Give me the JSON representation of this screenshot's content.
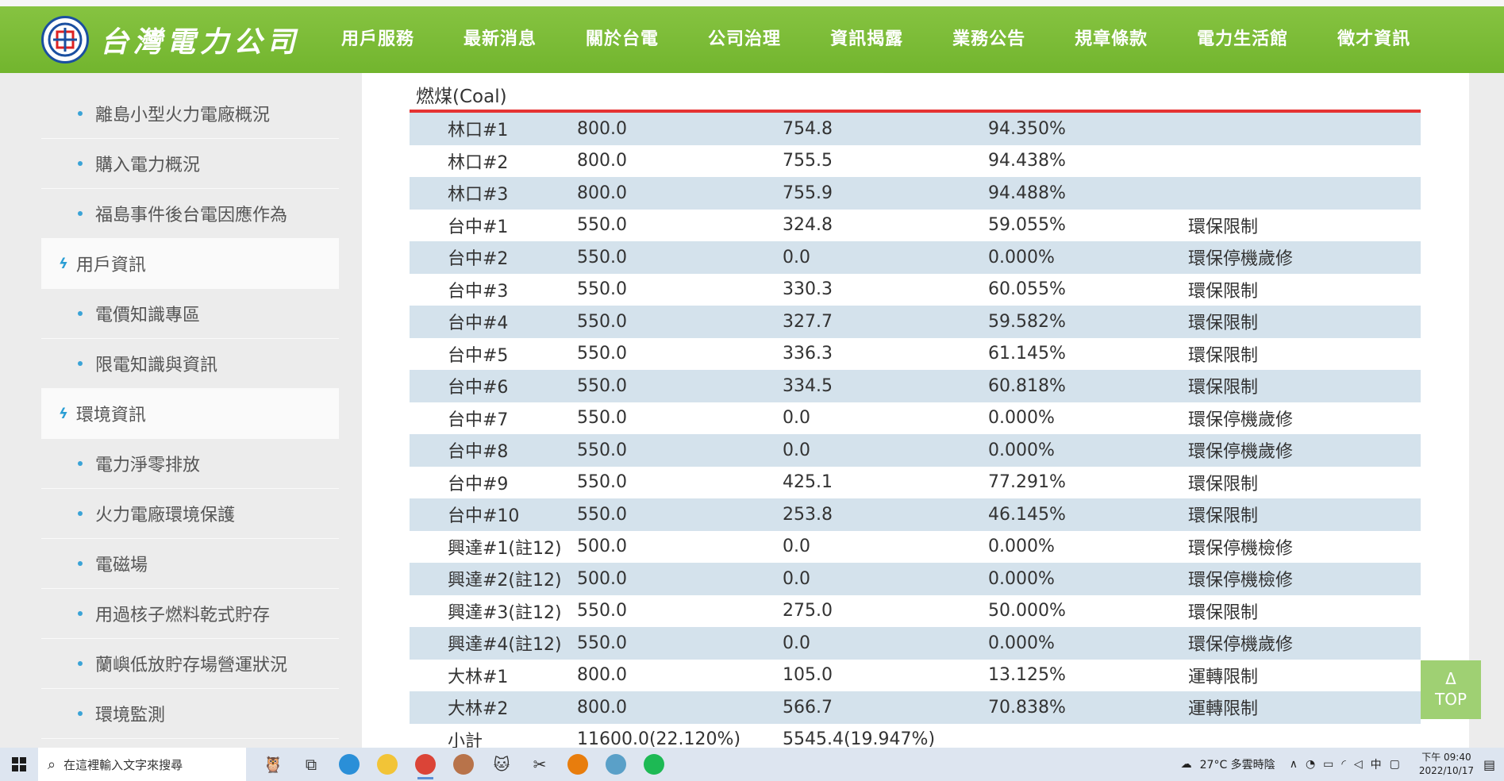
{
  "header": {
    "logo_text": "台灣電力公司",
    "nav": [
      "用戶服務",
      "最新消息",
      "關於台電",
      "公司治理",
      "資訊揭露",
      "業務公告",
      "規章條款",
      "電力生活館",
      "徵才資訊"
    ],
    "active_index": 4,
    "color": "#76b830"
  },
  "sidebar": {
    "items": [
      {
        "type": "sub",
        "label": "離島小型火力電廠概況"
      },
      {
        "type": "sub",
        "label": "購入電力概況"
      },
      {
        "type": "sub",
        "label": "福島事件後台電因應作為"
      },
      {
        "type": "cat",
        "label": "用戶資訊"
      },
      {
        "type": "sub",
        "label": "電價知識專區"
      },
      {
        "type": "sub",
        "label": "限電知識與資訊"
      },
      {
        "type": "cat",
        "label": "環境資訊"
      },
      {
        "type": "sub",
        "label": "電力淨零排放"
      },
      {
        "type": "sub",
        "label": "火力電廠環境保護"
      },
      {
        "type": "sub",
        "label": "電磁場"
      },
      {
        "type": "sub",
        "label": "用過核子燃料乾式貯存"
      },
      {
        "type": "sub",
        "label": "蘭嶼低放貯存場營運狀況"
      },
      {
        "type": "sub",
        "label": "環境監測"
      }
    ]
  },
  "content": {
    "section_title": "燃煤(Coal)",
    "accent_line_color": "#e53333",
    "row_color": "#d4e2ec",
    "rows": [
      [
        "林口#1",
        "800.0",
        "754.8",
        "94.350%",
        ""
      ],
      [
        "林口#2",
        "800.0",
        "755.5",
        "94.438%",
        ""
      ],
      [
        "林口#3",
        "800.0",
        "755.9",
        "94.488%",
        ""
      ],
      [
        "台中#1",
        "550.0",
        "324.8",
        "59.055%",
        "環保限制"
      ],
      [
        "台中#2",
        "550.0",
        "0.0",
        "0.000%",
        "環保停機歲修"
      ],
      [
        "台中#3",
        "550.0",
        "330.3",
        "60.055%",
        "環保限制"
      ],
      [
        "台中#4",
        "550.0",
        "327.7",
        "59.582%",
        "環保限制"
      ],
      [
        "台中#5",
        "550.0",
        "336.3",
        "61.145%",
        "環保限制"
      ],
      [
        "台中#6",
        "550.0",
        "334.5",
        "60.818%",
        "環保限制"
      ],
      [
        "台中#7",
        "550.0",
        "0.0",
        "0.000%",
        "環保停機歲修"
      ],
      [
        "台中#8",
        "550.0",
        "0.0",
        "0.000%",
        "環保停機歲修"
      ],
      [
        "台中#9",
        "550.0",
        "425.1",
        "77.291%",
        "環保限制"
      ],
      [
        "台中#10",
        "550.0",
        "253.8",
        "46.145%",
        "環保限制"
      ],
      [
        "興達#1(註12)",
        "500.0",
        "0.0",
        "0.000%",
        "環保停機檢修"
      ],
      [
        "興達#2(註12)",
        "500.0",
        "0.0",
        "0.000%",
        "環保停機檢修"
      ],
      [
        "興達#3(註12)",
        "550.0",
        "275.0",
        "50.000%",
        "環保限制"
      ],
      [
        "興達#4(註12)",
        "550.0",
        "0.0",
        "0.000%",
        "環保停機歲修"
      ],
      [
        "大林#1",
        "800.0",
        "105.0",
        "13.125%",
        "運轉限制"
      ],
      [
        "大林#2",
        "800.0",
        "566.7",
        "70.838%",
        "運轉限制"
      ],
      [
        "小計",
        "11600.0(22.120%)",
        "5545.4(19.947%)",
        "",
        ""
      ]
    ]
  },
  "top_button": {
    "arrow": "Δ",
    "label": "TOP"
  },
  "taskbar": {
    "search_placeholder": "在這裡輸入文字來搜尋",
    "apps": [
      {
        "name": "owl-widget-icon",
        "glyph": "🦉",
        "color": ""
      },
      {
        "name": "task-view-icon",
        "glyph": "⧉",
        "color": ""
      },
      {
        "name": "edge-icon",
        "glyph": "",
        "color": "#2a8fd8"
      },
      {
        "name": "file-explorer-icon",
        "glyph": "",
        "color": "#f2c437"
      },
      {
        "name": "chrome-icon",
        "glyph": "",
        "color": "#db4437"
      },
      {
        "name": "compass-app-icon",
        "glyph": "",
        "color": "#b8734a"
      },
      {
        "name": "cat-app-icon",
        "glyph": "🐱",
        "color": ""
      },
      {
        "name": "snipping-tool-icon",
        "glyph": "✂",
        "color": ""
      },
      {
        "name": "blender-icon",
        "glyph": "",
        "color": "#e87d0d"
      },
      {
        "name": "notebook-app-icon",
        "glyph": "",
        "color": "#5aa0c8"
      },
      {
        "name": "spotify-icon",
        "glyph": "",
        "color": "#1db954"
      }
    ],
    "weather": "27°C 多雲時陰",
    "ime": "中",
    "time": "下午 09:40",
    "date": "2022/10/17"
  }
}
